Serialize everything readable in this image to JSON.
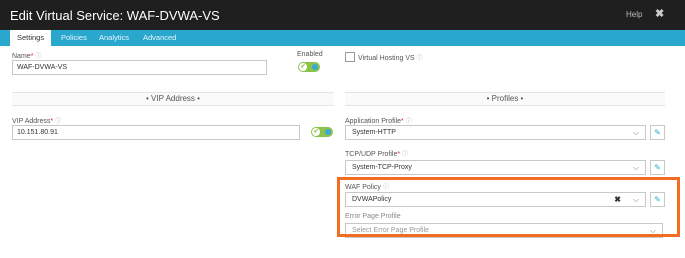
{
  "dialog": {
    "title": "Edit Virtual Service: WAF-DVWA-VS",
    "help_label": "Help",
    "close_glyph": "✖"
  },
  "tabs": [
    {
      "label": "Settings",
      "active": true
    },
    {
      "label": "Policies",
      "active": false
    },
    {
      "label": "Analytics",
      "active": false
    },
    {
      "label": "Advanced",
      "active": false
    }
  ],
  "form": {
    "name_label": "Name",
    "name_value": "WAF-DVWA-VS",
    "enabled_label": "Enabled",
    "enabled": true,
    "virtual_hosting_label": "Virtual Hosting VS",
    "virtual_hosting_checked": false,
    "vip_section_title": "• VIP Address •",
    "vip_address_label": "VIP Address",
    "vip_address_value": "10.151.80.91",
    "vip_enabled": true,
    "profiles_section_title": "• Profiles •",
    "app_profile_label": "Application Profile",
    "app_profile_value": "System-HTTP",
    "tcp_profile_label": "TCP/UDP Profile",
    "tcp_profile_value": "System-TCP-Proxy",
    "waf_policy_label": "WAF Policy",
    "waf_policy_value": "DVWAPolicy",
    "error_page_label": "Error Page Profile",
    "error_page_placeholder": "Select Error Page Profile"
  },
  "colors": {
    "titlebar": "#1f1f1f",
    "tabbar": "#2aa7cc",
    "highlight": "#f26d21",
    "toggle_on": "#8bc34a"
  },
  "icons": {
    "required": "*",
    "info": "ⓘ",
    "chevron": "⌵",
    "edit": "✎",
    "clear": "✖",
    "check": "✔"
  }
}
